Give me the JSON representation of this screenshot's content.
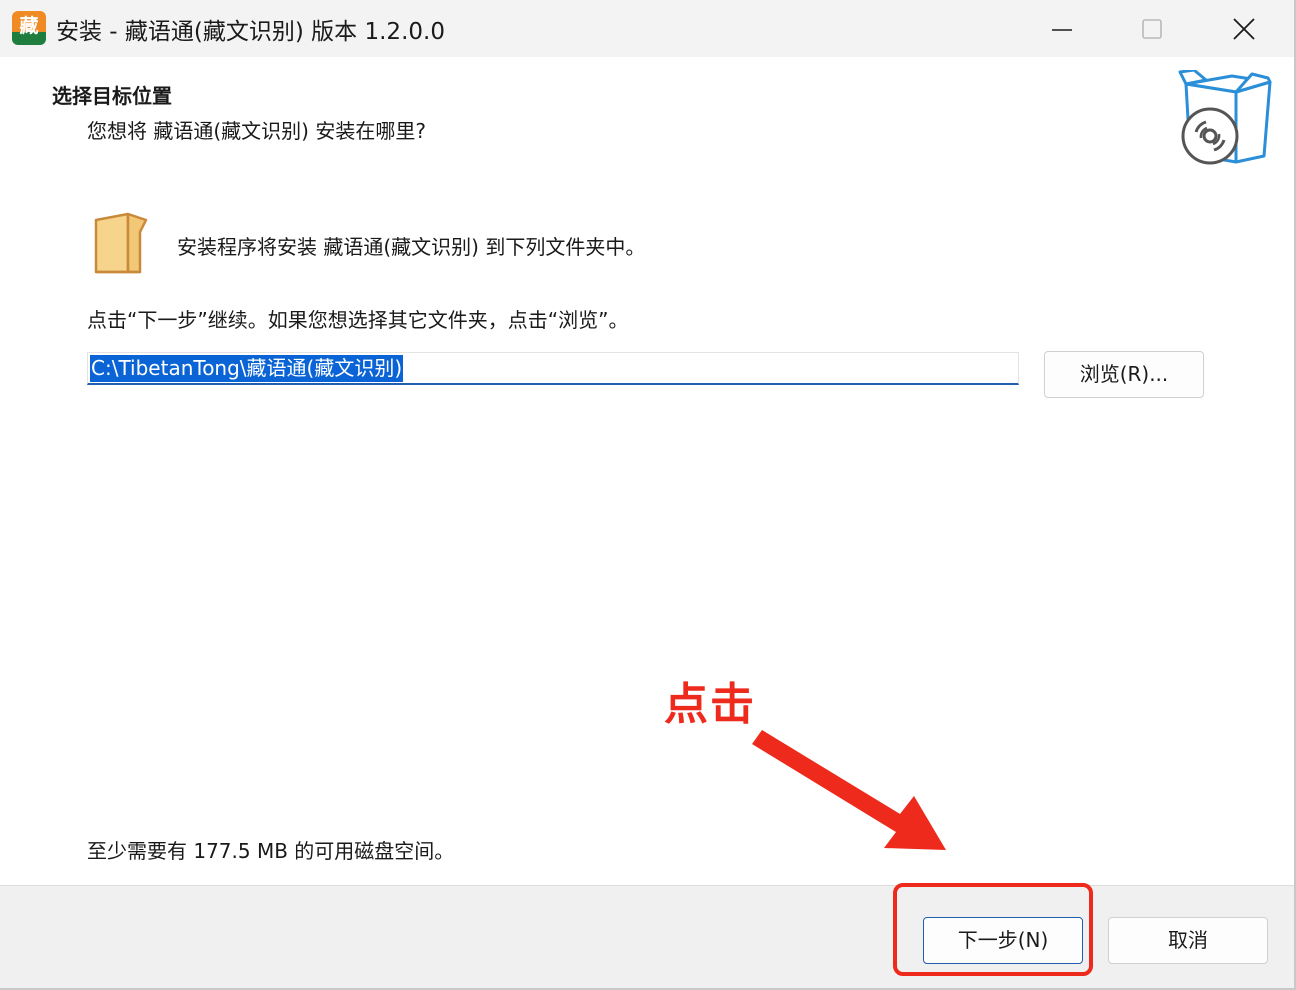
{
  "window": {
    "app_icon_text": "藏",
    "title": "安装 - 藏语通(藏文识别) 版本 1.2.0.0"
  },
  "header": {
    "heading": "选择目标位置",
    "subheading": "您想将 藏语通(藏文识别) 安装在哪里?"
  },
  "body": {
    "install_info": "安装程序将安装 藏语通(藏文识别) 到下列文件夹中。",
    "continue_text": "点击“下一步”继续。如果您想选择其它文件夹，点击“浏览”。",
    "path_value": "C:\\TibetanTong\\藏语通(藏文识别)",
    "browse_label": "浏览(R)...",
    "disk_space": "至少需要有 177.5 MB 的可用磁盘空间。"
  },
  "footer": {
    "next_label": "下一步(N)",
    "cancel_label": "取消"
  },
  "annotation": {
    "label": "点击",
    "color": "#ee2a1c"
  },
  "colors": {
    "accent": "#1f5fae",
    "selection": "#0a64d6",
    "folder": "#f6d48c",
    "box": "#2a8fd8"
  }
}
